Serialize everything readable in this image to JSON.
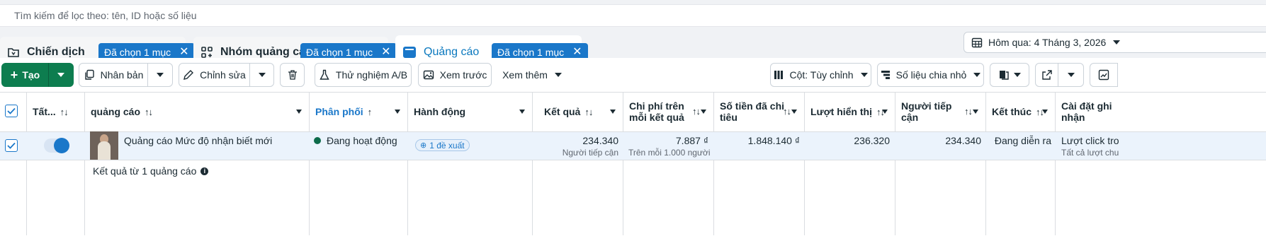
{
  "search": {
    "placeholder": "Tìm kiếm để lọc theo: tên, ID hoặc số liệu"
  },
  "tabs": [
    {
      "label": "Chiến dịch",
      "chip": "Đã chọn 1 mục"
    },
    {
      "label": "Nhóm quảng cáo",
      "chip": "Đã chọn 1 mục"
    },
    {
      "label": "Quảng cáo",
      "chip": "Đã chọn 1 mục"
    }
  ],
  "date_range": "Hôm qua: 4 Tháng 3, 2026",
  "toolbar": {
    "create": "Tạo",
    "duplicate": "Nhân bản",
    "edit": "Chỉnh sửa",
    "ab_test": "Thử nghiệm A/B",
    "preview": "Xem trước",
    "more": "Xem thêm",
    "columns": "Cột: Tùy chỉnh",
    "breakdown": "Số liệu chia nhỏ"
  },
  "columns": {
    "all": "Tất...",
    "ad": "quảng cáo",
    "delivery": "Phân phối",
    "actions": "Hành động",
    "results": "Kết quả",
    "cost_per_result_1": "Chi phí trên",
    "cost_per_result_2": "mỗi kết quả",
    "amount_spent_1": "Số tiền đã chi",
    "amount_spent_2": "tiêu",
    "impressions": "Lượt hiển thị",
    "reach_1": "Người tiếp",
    "reach_2": "cận",
    "ends": "Kết thúc",
    "settings_1": "Cài đặt ghi",
    "settings_2": "nhận"
  },
  "row": {
    "name": "Quảng cáo Mức độ nhận biết mới",
    "delivery": "Đang hoạt động",
    "actions_badge": "1 đề xuất",
    "results": "234.340",
    "results_sub": "Người tiếp cận",
    "cost_per_result": "7.887 ₫",
    "cost_per_result_sub": "Trên mỗi 1.000 người ...",
    "amount_spent": "1.848.140 ₫",
    "impressions": "236.320",
    "reach": "234.340",
    "ends": "Đang diễn ra",
    "settings": "Lượt click tro",
    "settings_sub": "Tất cả lượt chu"
  },
  "summary": "Kết quả từ 1 quảng cáo",
  "colors": {
    "accent": "#1a77c9",
    "create": "#0d7d4f",
    "active_dot": "#0d6b4a"
  }
}
